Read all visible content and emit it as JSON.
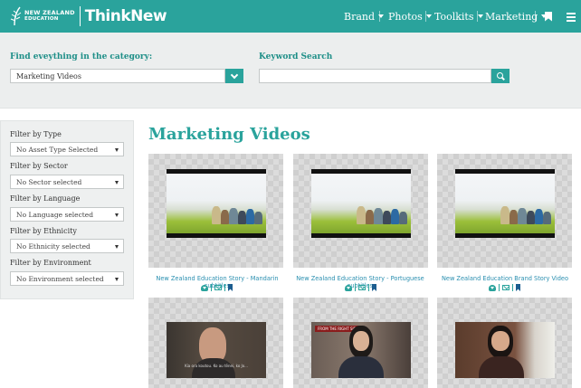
{
  "colors": {
    "brand": "#2aa39c",
    "link": "#2a8fb0",
    "bookmark": "#1c5d8f"
  },
  "header": {
    "logo_line1": "NEW ZEALAND",
    "logo_line2": "EDUCATION",
    "logo_product": "ThinkNew",
    "nav": [
      {
        "label": "Brand"
      },
      {
        "label": "Photos"
      },
      {
        "label": "Toolkits"
      },
      {
        "label": "Marketing"
      }
    ],
    "bookmark_icon": "bookmark-icon",
    "menu_icon": "hamburger-icon"
  },
  "search": {
    "category_label": "Find eveything in the category:",
    "category_value": "Marketing Videos",
    "keyword_label": "Keyword Search",
    "keyword_value": "",
    "search_icon": "search-icon"
  },
  "filters": [
    {
      "label": "Filter by Type",
      "value": "No Asset Type Selected"
    },
    {
      "label": "Filter by Sector",
      "value": "No Sector selected"
    },
    {
      "label": "Filter by Language",
      "value": "No Language selected"
    },
    {
      "label": "Filter by Ethnicity",
      "value": "No Ethnicity selected"
    },
    {
      "label": "Filter by Environment",
      "value": "No Environment selected"
    }
  ],
  "main": {
    "heading": "Marketing Videos",
    "cards": [
      {
        "title": "New Zealand Education Story - Mandarin subtitles"
      },
      {
        "title": "New Zealand Education Story - Portuguese subtitles"
      },
      {
        "title": "New Zealand Education Brand Story Video"
      }
    ],
    "bottom_cards": [
      {
        "subtitle_text": "Kia ora koutou. Ko au tēnei, ko Jo..."
      },
      {
        "banner_text": "FROM THE RIGHT SIDE"
      },
      {}
    ],
    "action_icons": [
      "download-icon",
      "email-icon",
      "bookmark-icon"
    ]
  }
}
